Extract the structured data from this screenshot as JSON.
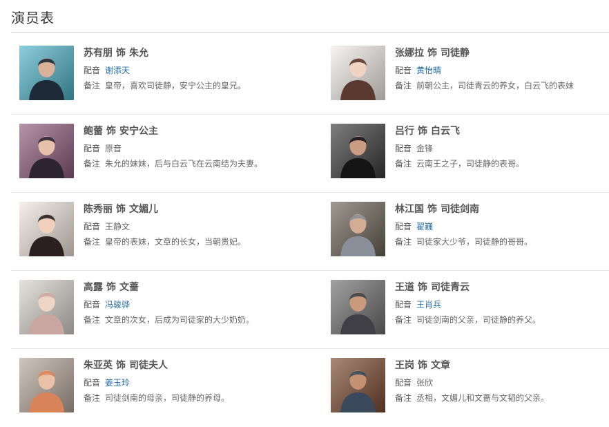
{
  "section": {
    "title": "演员表"
  },
  "labels": {
    "connector": "饰",
    "dub": "配音",
    "note": "备注"
  },
  "cast": [
    {
      "actor": "苏有朋",
      "role": "朱允",
      "dub": "谢添天",
      "dub_link": true,
      "note": "皇帝，喜欢司徒静，安宁公主的皇兄。",
      "photo": {
        "bg": "#4fb3c9",
        "figure": "#1e2a38",
        "skin": "#d9b299"
      }
    },
    {
      "actor": "张娜拉",
      "role": "司徒静",
      "dub": "黄怡晴",
      "dub_link": true,
      "note": "前朝公主，司徒青云的养女，白云飞的表妹",
      "photo": {
        "bg": "#f3eee9",
        "figure": "#5a3a30",
        "skin": "#f1d3c2"
      }
    },
    {
      "actor": "鲍蕾",
      "role": "安宁公主",
      "dub": "原音",
      "dub_link": false,
      "note": "朱允的妹妹，后与白云飞在云南结为夫妻。",
      "photo": {
        "bg": "#8e5a7c",
        "figure": "#2c2433",
        "skin": "#e6c0aa"
      }
    },
    {
      "actor": "吕行",
      "role": "白云飞",
      "dub": "金锋",
      "dub_link": false,
      "note": "云南王之子，司徒静的表哥。",
      "photo": {
        "bg": "#3a3a3a",
        "figure": "#151515",
        "skin": "#c99d84"
      }
    },
    {
      "actor": "陈秀丽",
      "role": "文媚儿",
      "dub": "王静文",
      "dub_link": false,
      "note": "皇帝的表妹，文章的长女，当朝贵妃。",
      "photo": {
        "bg": "#f1e7df",
        "figure": "#2b2020",
        "skin": "#f0d0bd"
      }
    },
    {
      "actor": "林江国",
      "role": "司徒剑南",
      "dub": "翟巍",
      "dub_link": true,
      "note": "司徒家大少爷，司徒静的哥哥。",
      "photo": {
        "bg": "#6b6257",
        "figure": "#8a8f99",
        "skin": "#d3ad93"
      }
    },
    {
      "actor": "高露",
      "role": "文蔷",
      "dub": "冯骏骅",
      "dub_link": true,
      "note": "文章的次女，后成为司徒家的大少奶奶。",
      "photo": {
        "bg": "#d8d3cd",
        "figure": "#c9a6a0",
        "skin": "#efd5c4"
      }
    },
    {
      "actor": "王道",
      "role": "司徒青云",
      "dub": "王肖兵",
      "dub_link": true,
      "note": "司徒剑南的父亲，司徒静的养父。",
      "photo": {
        "bg": "#6f6f6f",
        "figure": "#3f3f45",
        "skin": "#c99a7c"
      }
    },
    {
      "actor": "朱亚英",
      "role": "司徒夫人",
      "dub": "姜玉玲",
      "dub_link": true,
      "note": "司徒剑南的母亲，司徒静的养母。",
      "photo": {
        "bg": "#b8a79a",
        "figure": "#d8835a",
        "skin": "#e8c1a6"
      }
    },
    {
      "actor": "王岗",
      "role": "文章",
      "dub": "张欣",
      "dub_link": false,
      "note": "丞相，文媚儿和文蔷与文韬的父亲。",
      "photo": {
        "bg": "#7a4a2e",
        "figure": "#3a4a5c",
        "skin": "#c49273"
      }
    }
  ]
}
